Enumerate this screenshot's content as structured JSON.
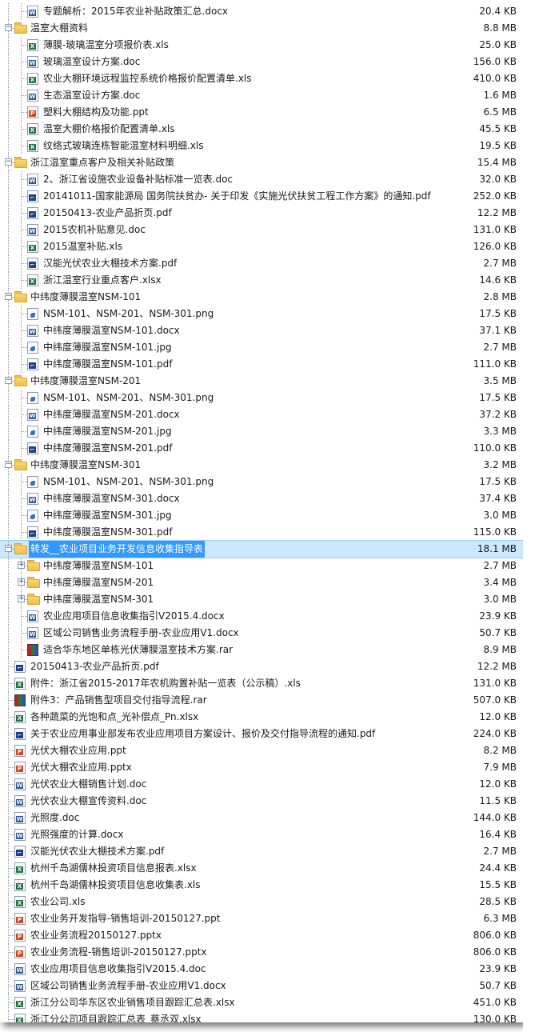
{
  "rows": [
    {
      "lvl": 1,
      "type": "w",
      "name": "专题解析：2015年农业补贴政策汇总.docx",
      "size": "20.4 KB"
    },
    {
      "lvl": 0,
      "type": "folder",
      "toggle": "-",
      "name": "温室大棚资料",
      "size": "8.8 MB"
    },
    {
      "lvl": 1,
      "type": "x",
      "name": "薄膜-玻璃温室分项报价表.xls",
      "size": "25.0 KB"
    },
    {
      "lvl": 1,
      "type": "w",
      "name": "玻璃温室设计方案.doc",
      "size": "156.0 KB"
    },
    {
      "lvl": 1,
      "type": "x",
      "name": "农业大棚环境远程监控系统价格报价配置清单.xls",
      "size": "410.0 KB"
    },
    {
      "lvl": 1,
      "type": "w",
      "name": "生态温室设计方案.doc",
      "size": "1.6 MB"
    },
    {
      "lvl": 1,
      "type": "p",
      "name": "塑料大棚结构及功能.ppt",
      "size": "6.5 MB"
    },
    {
      "lvl": 1,
      "type": "x",
      "name": "温室大棚价格报价配置清单.xls",
      "size": "45.5 KB"
    },
    {
      "lvl": 1,
      "type": "x",
      "name": "纹络式玻璃连栋智能温室材料明细.xls",
      "size": "19.5 KB"
    },
    {
      "lvl": 0,
      "type": "folder",
      "toggle": "-",
      "name": "浙江温室重点客户及相关补贴政策",
      "size": "15.4 MB"
    },
    {
      "lvl": 1,
      "type": "w",
      "name": "2、浙江省设施农业设备补贴标准一览表.doc",
      "size": "32.0 KB"
    },
    {
      "lvl": 1,
      "type": "pdf",
      "name": "20141011-国家能源局 国务院扶贫办- 关于印发《实施光伏扶贫工程工作方案》的通知.pdf",
      "size": "252.0 KB"
    },
    {
      "lvl": 1,
      "type": "pdf",
      "name": "20150413-农业产品折页.pdf",
      "size": "12.2 MB"
    },
    {
      "lvl": 1,
      "type": "w",
      "name": "2015农机补贴意见.doc",
      "size": "131.0 KB"
    },
    {
      "lvl": 1,
      "type": "x",
      "name": "2015温室补贴.xls",
      "size": "126.0 KB"
    },
    {
      "lvl": 1,
      "type": "pdf",
      "name": "汉能光伏农业大棚技术方案.pdf",
      "size": "2.7 MB"
    },
    {
      "lvl": 1,
      "type": "x",
      "name": "浙江温室行业重点客户.xlsx",
      "size": "14.6 KB"
    },
    {
      "lvl": 0,
      "type": "folder",
      "toggle": "-",
      "name": "中纬度薄膜温室NSM-101",
      "size": "2.8 MB"
    },
    {
      "lvl": 1,
      "type": "img",
      "name": "NSM-101、NSM-201、NSM-301.png",
      "size": "17.5 KB"
    },
    {
      "lvl": 1,
      "type": "w",
      "name": "中纬度薄膜温室NSM-101.docx",
      "size": "37.1 KB"
    },
    {
      "lvl": 1,
      "type": "img",
      "name": "中纬度薄膜温室NSM-101.jpg",
      "size": "2.7 MB"
    },
    {
      "lvl": 1,
      "type": "pdf",
      "name": "中纬度薄膜温室NSM-101.pdf",
      "size": "111.0 KB"
    },
    {
      "lvl": 0,
      "type": "folder",
      "toggle": "-",
      "name": "中纬度薄膜温室NSM-201",
      "size": "3.5 MB"
    },
    {
      "lvl": 1,
      "type": "img",
      "name": "NSM-101、NSM-201、NSM-301.png",
      "size": "17.5 KB"
    },
    {
      "lvl": 1,
      "type": "w",
      "name": "中纬度薄膜温室NSM-201.docx",
      "size": "37.2 KB"
    },
    {
      "lvl": 1,
      "type": "img",
      "name": "中纬度薄膜温室NSM-201.jpg",
      "size": "3.3 MB"
    },
    {
      "lvl": 1,
      "type": "pdf",
      "name": "中纬度薄膜温室NSM-201.pdf",
      "size": "110.0 KB"
    },
    {
      "lvl": 0,
      "type": "folder",
      "toggle": "-",
      "name": "中纬度薄膜温室NSM-301",
      "size": "3.2 MB"
    },
    {
      "lvl": 1,
      "type": "img",
      "name": "NSM-101、NSM-201、NSM-301.png",
      "size": "17.5 KB"
    },
    {
      "lvl": 1,
      "type": "w",
      "name": "中纬度薄膜温室NSM-301.docx",
      "size": "37.4 KB"
    },
    {
      "lvl": 1,
      "type": "img",
      "name": "中纬度薄膜温室NSM-301.jpg",
      "size": "3.0 MB"
    },
    {
      "lvl": 1,
      "type": "pdf",
      "name": "中纬度薄膜温室NSM-301.pdf",
      "size": "115.0 KB"
    },
    {
      "lvl": 0,
      "type": "folder",
      "toggle": "-",
      "name": "转发__农业项目业务开发信息收集指导表",
      "size": "18.1 MB",
      "selected": true
    },
    {
      "lvl": 1,
      "type": "folder",
      "toggle": "+",
      "name": "中纬度薄膜温室NSM-101",
      "size": "2.7 MB"
    },
    {
      "lvl": 1,
      "type": "folder",
      "toggle": "+",
      "name": "中纬度薄膜温室NSM-201",
      "size": "3.4 MB"
    },
    {
      "lvl": 1,
      "type": "folder",
      "toggle": "+",
      "name": "中纬度薄膜温室NSM-301",
      "size": "3.0 MB"
    },
    {
      "lvl": 1,
      "type": "w",
      "name": "农业应用项目信息收集指引V2015.4.docx",
      "size": "23.9 KB"
    },
    {
      "lvl": 1,
      "type": "w",
      "name": "区域公司销售业务流程手册-农业应用V1.docx",
      "size": "50.7 KB"
    },
    {
      "lvl": 1,
      "type": "rar",
      "name": "适合华东地区单栋光伏薄膜温室技术方案.rar",
      "size": "8.9 MB"
    },
    {
      "lvl": 0,
      "type": "pdf",
      "name": "20150413-农业产品折页.pdf",
      "size": "12.2 MB"
    },
    {
      "lvl": 0,
      "type": "x",
      "name": "附件：浙江省2015-2017年农机购置补贴一览表（公示稿）.xls",
      "size": "131.0 KB"
    },
    {
      "lvl": 0,
      "type": "rar",
      "name": "附件3：产品销售型项目交付指导流程.rar",
      "size": "507.0 KB"
    },
    {
      "lvl": 0,
      "type": "x",
      "name": "各种蔬菜的光饱和点_光补偿点_Pn.xlsx",
      "size": "12.0 KB"
    },
    {
      "lvl": 0,
      "type": "pdf",
      "name": "关于农业应用事业部发布农业应用项目方案设计、报价及交付指导流程的通知.pdf",
      "size": "224.0 KB"
    },
    {
      "lvl": 0,
      "type": "p",
      "name": "光伏大棚农业应用.ppt",
      "size": "8.2 MB"
    },
    {
      "lvl": 0,
      "type": "p",
      "name": "光伏大棚农业应用.pptx",
      "size": "7.9 MB"
    },
    {
      "lvl": 0,
      "type": "w",
      "name": "光伏农业大棚销售计划.doc",
      "size": "12.0 KB"
    },
    {
      "lvl": 0,
      "type": "w",
      "name": "光伏农业大棚宣传资料.doc",
      "size": "11.5 KB"
    },
    {
      "lvl": 0,
      "type": "w",
      "name": "光照度.doc",
      "size": "144.0 KB"
    },
    {
      "lvl": 0,
      "type": "w",
      "name": "光照强度的计算.docx",
      "size": "16.4 KB"
    },
    {
      "lvl": 0,
      "type": "pdf",
      "name": "汉能光伏农业大棚技术方案.pdf",
      "size": "2.7 MB"
    },
    {
      "lvl": 0,
      "type": "x",
      "name": "杭州千岛湖儒林投资项目信息报表.xlsx",
      "size": "24.4 KB"
    },
    {
      "lvl": 0,
      "type": "x",
      "name": "杭州千岛湖儒林投资项目信息收集表.xls",
      "size": "15.5 KB"
    },
    {
      "lvl": 0,
      "type": "x",
      "name": "农业公司.xls",
      "size": "28.5 KB"
    },
    {
      "lvl": 0,
      "type": "p",
      "name": "农业业务开发指导-销售培训-20150127.ppt",
      "size": "6.3 MB"
    },
    {
      "lvl": 0,
      "type": "p",
      "name": "农业业务流程20150127.pptx",
      "size": "806.0 KB"
    },
    {
      "lvl": 0,
      "type": "p",
      "name": "农业业务流程-销售培训-20150127.pptx",
      "size": "806.0 KB"
    },
    {
      "lvl": 0,
      "type": "w",
      "name": "农业应用项目信息收集指引V2015.4.doc",
      "size": "23.9 KB"
    },
    {
      "lvl": 0,
      "type": "w",
      "name": "区域公司销售业务流程手册-农业应用V1.docx",
      "size": "50.7 KB"
    },
    {
      "lvl": 0,
      "type": "x",
      "name": "浙江分公司华东区农业销售项目跟踪汇总表.xlsx",
      "size": "451.0 KB"
    },
    {
      "lvl": 0,
      "type": "x",
      "name": "浙江分公司项目跟踪汇总表_蔡丞双.xlsx",
      "size": "130.0 KB"
    }
  ]
}
